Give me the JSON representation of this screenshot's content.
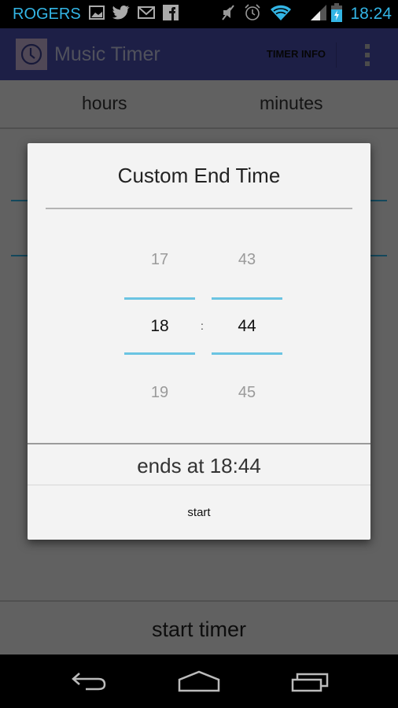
{
  "status_bar": {
    "carrier": "ROGERS",
    "time": "18:24",
    "left_icons": [
      "gallery-icon",
      "twitter-icon",
      "gmail-icon",
      "facebook-icon"
    ],
    "right_icons": [
      "mute-icon",
      "alarm-icon",
      "wifi-icon",
      "signal-icon",
      "battery-charging-icon"
    ],
    "accent_color": "#33b5e5"
  },
  "action_bar": {
    "app_icon": "clock-icon",
    "title": "Music Timer",
    "timer_info_label": "TIMER INFO",
    "overflow_icon": "overflow-menu-icon",
    "color": "#4a4fb0"
  },
  "main": {
    "columns": {
      "hours": "hours",
      "minutes": "minutes"
    },
    "start_timer_label": "start timer"
  },
  "dialog": {
    "title": "Custom End Time",
    "hour_picker": {
      "prev": "17",
      "selected": "18",
      "next": "19"
    },
    "separator": ":",
    "minute_picker": {
      "prev": "43",
      "selected": "44",
      "next": "45"
    },
    "ends_at": "ends at 18:44",
    "start_label": "start",
    "picker_line_color": "#6ac4e2"
  },
  "nav_bar": {
    "back": "back-icon",
    "home": "home-icon",
    "recents": "recent-apps-icon"
  }
}
